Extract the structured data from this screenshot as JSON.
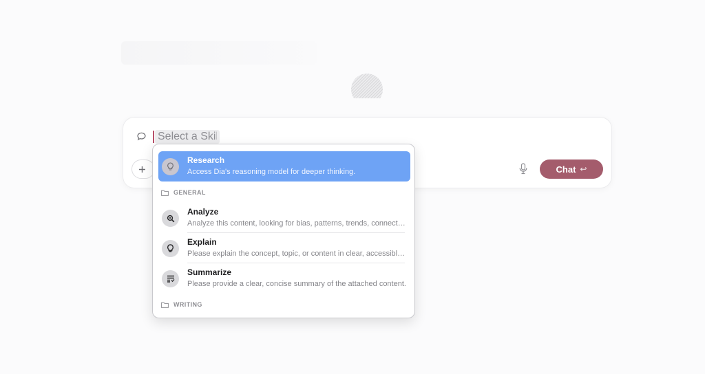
{
  "composer": {
    "input_placeholder": "Select a Skill",
    "chat_button_label": "Chat",
    "icons": {
      "leading": "chat-bubble-icon",
      "add": "plus-icon",
      "mic": "microphone-icon",
      "submit": "return-icon"
    }
  },
  "dropdown": {
    "selected_item": {
      "title": "Research",
      "description": "Access Dia's reasoning model for deeper thinking.",
      "icon": "lightbulb-icon"
    },
    "sections": [
      {
        "label": "GENERAL",
        "icon": "folder-icon",
        "items": [
          {
            "title": "Analyze",
            "description": "Analyze this content, looking for bias, patterns, trends, connections, and key insights.",
            "icon": "magnifier-icon"
          },
          {
            "title": "Explain",
            "description": "Please explain the concept, topic, or content in clear, accessible language.",
            "icon": "lightbulb-icon"
          },
          {
            "title": "Summarize",
            "description": "Please provide a clear, concise summary of the attached content.",
            "icon": "summary-list-icon"
          }
        ]
      },
      {
        "label": "WRITING",
        "icon": "folder-icon",
        "items": []
      }
    ]
  },
  "colors": {
    "accent_selected": "#6ea3f5",
    "chat_button": "#a45c6c",
    "caret": "#b8506a"
  }
}
